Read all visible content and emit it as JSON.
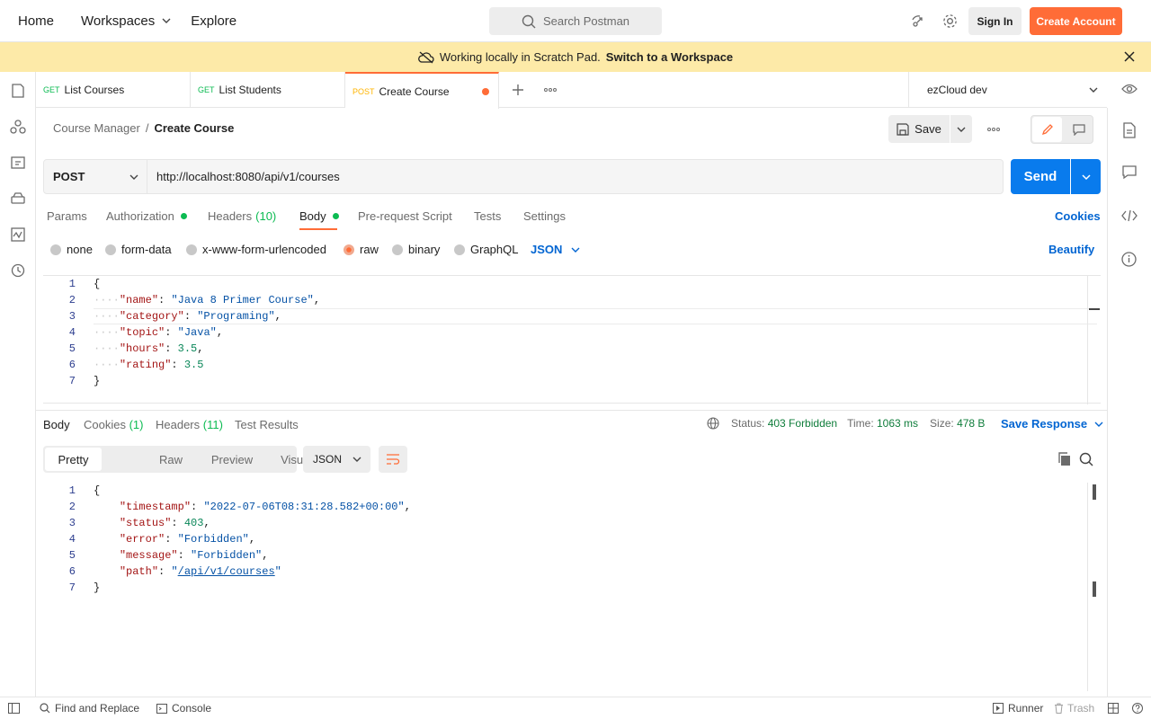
{
  "nav": {
    "home": "Home",
    "workspaces": "Workspaces",
    "explore": "Explore"
  },
  "search": {
    "placeholder": "Search Postman"
  },
  "account": {
    "sign_in": "Sign In",
    "create": "Create Account"
  },
  "banner": {
    "text": "Working locally in Scratch Pad.",
    "link": "Switch to a Workspace"
  },
  "tabs": [
    {
      "method": "GET",
      "label": "List Courses"
    },
    {
      "method": "GET",
      "label": "List Students"
    },
    {
      "method": "POST",
      "label": "Create Course"
    }
  ],
  "environment": "ezCloud dev",
  "breadcrumb": {
    "collection": "Course Manager",
    "separator": "/",
    "request": "Create Course"
  },
  "save_label": "Save",
  "request": {
    "method": "POST",
    "url": "http://localhost:8080/api/v1/courses",
    "send": "Send"
  },
  "request_tabs": {
    "params": "Params",
    "authorization": "Authorization",
    "headers": "Headers",
    "headers_count": "(10)",
    "body": "Body",
    "prerequest": "Pre-request Script",
    "tests": "Tests",
    "settings": "Settings",
    "cookies": "Cookies"
  },
  "body_types": {
    "none": "none",
    "form_data": "form-data",
    "urlencoded": "x-www-form-urlencoded",
    "raw": "raw",
    "binary": "binary",
    "graphql": "GraphQL",
    "format": "JSON",
    "beautify": "Beautify"
  },
  "request_body": {
    "line_numbers": [
      "1",
      "2",
      "3",
      "4",
      "5",
      "6",
      "7"
    ],
    "open": "{",
    "close": "}",
    "name_key": "\"name\"",
    "name_val": "\"Java 8 Primer Course\"",
    "category_key": "\"category\"",
    "category_val": "\"Programing\"",
    "topic_key": "\"topic\"",
    "topic_val": "\"Java\"",
    "hours_key": "\"hours\"",
    "hours_val": "3.5",
    "rating_key": "\"rating\"",
    "rating_val": "3.5"
  },
  "response_tabs": {
    "body": "Body",
    "cookies": "Cookies",
    "cookies_count": "(1)",
    "headers": "Headers",
    "headers_count": "(11)",
    "test_results": "Test Results"
  },
  "response_meta": {
    "status_label": "Status:",
    "status": "403 Forbidden",
    "time_label": "Time:",
    "time": "1063 ms",
    "size_label": "Size:",
    "size": "478 B",
    "save_response": "Save Response"
  },
  "view_modes": {
    "pretty": "Pretty",
    "raw": "Raw",
    "preview": "Preview",
    "visualize": "Visualize",
    "format": "JSON"
  },
  "response_body": {
    "line_numbers": [
      "1",
      "2",
      "3",
      "4",
      "5",
      "6",
      "7"
    ],
    "open": "{",
    "close": "}",
    "timestamp_key": "\"timestamp\"",
    "timestamp_val": "\"2022-07-06T08:31:28.582+00:00\"",
    "status_key": "\"status\"",
    "status_val": "403",
    "error_key": "\"error\"",
    "error_val": "\"Forbidden\"",
    "message_key": "\"message\"",
    "message_val": "\"Forbidden\"",
    "path_key": "\"path\"",
    "path_val_q1": "\"",
    "path_val": "/api/v1/courses",
    "path_val_q2": "\""
  },
  "footer": {
    "find_replace": "Find and Replace",
    "console": "Console",
    "runner": "Runner",
    "trash": "Trash"
  },
  "colors": {
    "accent": "#ff6c37",
    "primary": "#097bed",
    "banner": "#fdeaa8",
    "success": "#0cbb52"
  }
}
